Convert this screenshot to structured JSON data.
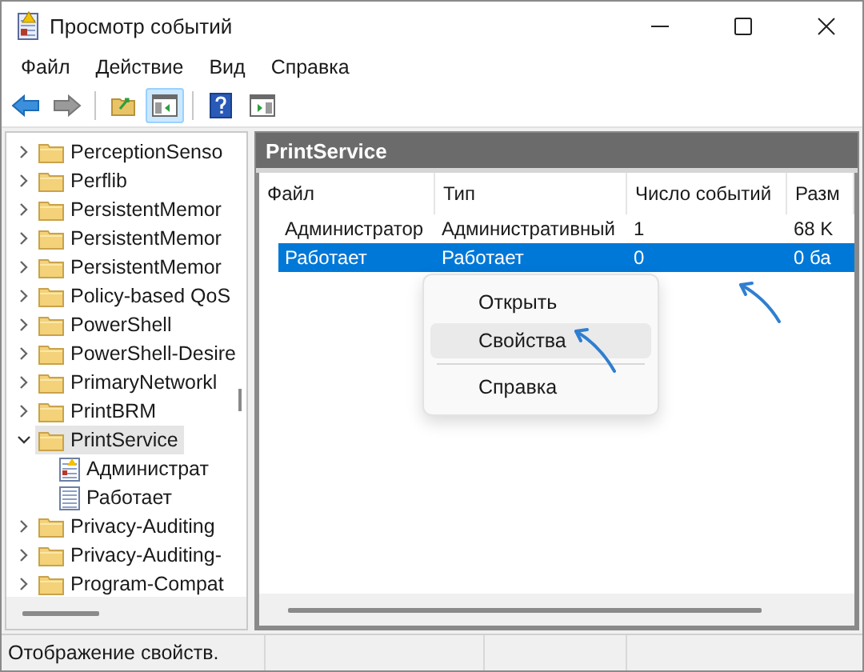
{
  "window": {
    "title": "Просмотр событий"
  },
  "menu": [
    "Файл",
    "Действие",
    "Вид",
    "Справка"
  ],
  "toolbar": [
    {
      "kind": "back",
      "pressed": false
    },
    {
      "kind": "forward",
      "pressed": false
    },
    {
      "kind": "folder-up",
      "pressed": false
    },
    {
      "kind": "tree-pane",
      "pressed": true
    },
    {
      "kind": "help",
      "pressed": false
    },
    {
      "kind": "action-pane",
      "pressed": false
    }
  ],
  "tree": {
    "items": [
      {
        "label": "PerceptionSenso",
        "kind": "folder",
        "expanded": false,
        "selected": false
      },
      {
        "label": "Perflib",
        "kind": "folder",
        "expanded": false,
        "selected": false
      },
      {
        "label": "PersistentMemor",
        "kind": "folder",
        "expanded": false,
        "selected": false
      },
      {
        "label": "PersistentMemor",
        "kind": "folder",
        "expanded": false,
        "selected": false
      },
      {
        "label": "PersistentMemor",
        "kind": "folder",
        "expanded": false,
        "selected": false
      },
      {
        "label": "Policy-based QoS",
        "kind": "folder",
        "expanded": false,
        "selected": false
      },
      {
        "label": "PowerShell",
        "kind": "folder",
        "expanded": false,
        "selected": false
      },
      {
        "label": "PowerShell-Desire",
        "kind": "folder",
        "expanded": false,
        "selected": false
      },
      {
        "label": "PrimaryNetworkl",
        "kind": "folder",
        "expanded": false,
        "selected": false
      },
      {
        "label": "PrintBRM",
        "kind": "folder",
        "expanded": false,
        "selected": false
      },
      {
        "label": "PrintService",
        "kind": "folder",
        "expanded": true,
        "selected": true,
        "children": [
          {
            "label": "Администрат",
            "kind": "admin-log",
            "selected": false
          },
          {
            "label": "Работает",
            "kind": "log",
            "selected": false
          }
        ]
      },
      {
        "label": "Privacy-Auditing",
        "kind": "folder",
        "expanded": false,
        "selected": false
      },
      {
        "label": "Privacy-Auditing-",
        "kind": "folder",
        "expanded": false,
        "selected": false
      },
      {
        "label": "Program-Compat",
        "kind": "folder",
        "expanded": false,
        "selected": false
      }
    ]
  },
  "panel": {
    "title": "PrintService"
  },
  "table": {
    "columns": [
      "Файл",
      "Тип",
      "Число событий",
      "Разм"
    ],
    "rows": [
      {
        "cells": [
          "Администратор",
          "Административный",
          "1",
          "68 K"
        ],
        "selected": false
      },
      {
        "cells": [
          "Работает",
          "Работает",
          "0",
          "0 ба"
        ],
        "selected": true
      }
    ]
  },
  "context_menu": [
    {
      "kind": "item",
      "label": "Открыть",
      "selected": false
    },
    {
      "kind": "item",
      "label": "Свойства",
      "selected": true
    },
    {
      "kind": "separator"
    },
    {
      "kind": "item",
      "label": "Справка",
      "selected": false
    }
  ],
  "status_bar": [
    "Отображение свойств."
  ]
}
